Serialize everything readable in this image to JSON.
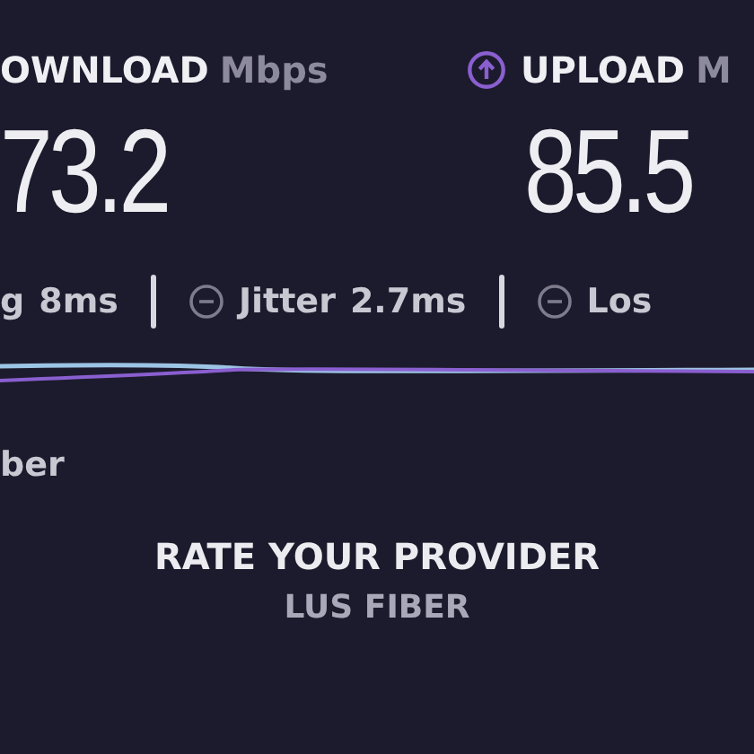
{
  "download": {
    "label": "OWNLOAD",
    "unit": "Mbps",
    "value": "73.2"
  },
  "upload": {
    "label": "UPLOAD",
    "unit": "M",
    "value": "85.5"
  },
  "metrics": [
    {
      "label": "g",
      "value": "8ms",
      "icon": false
    },
    {
      "label": "Jitter",
      "value": "2.7ms",
      "icon": true
    },
    {
      "label": "Los",
      "icon": true
    }
  ],
  "provider_fragment": "ber",
  "rating": {
    "title": "RATE YOUR PROVIDER",
    "provider": "LUS FIBER"
  }
}
